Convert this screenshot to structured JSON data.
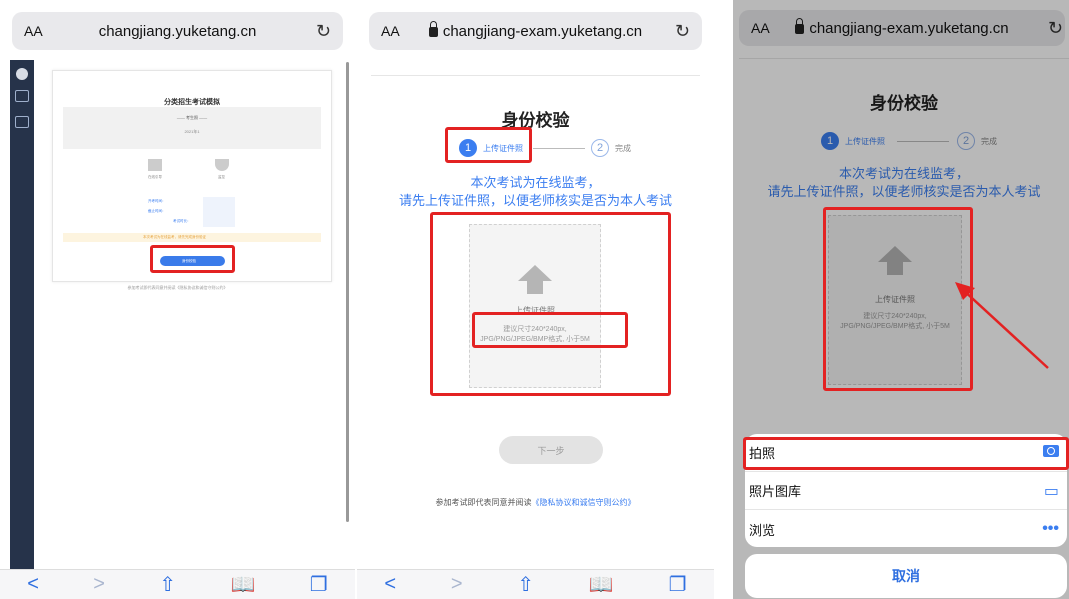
{
  "panel1": {
    "address": {
      "aa": "AA",
      "url": "changjiang.yuketang.cn",
      "reload": "↻"
    },
    "card_title": "分类招生考试模拟",
    "card_line": "—— 考生照 ——",
    "card_sub": "2021年1",
    "labels": [
      "在线引导",
      "监控"
    ],
    "info": [
      "开考时间：",
      "截止时间：",
      "考试时长："
    ],
    "warning": "本次考试为在线监考，请先完成身份验证",
    "button": "身份校验",
    "footer": "参加考试即代表同意并阅读《隐私协议和诚信守则公约》"
  },
  "panel2": {
    "address": {
      "aa": "AA",
      "url": "changjiang-exam.yuketang.cn",
      "reload": "↻"
    },
    "title": "身份校验",
    "step1_num": "1",
    "step1_label": "上传证件照",
    "step2_num": "2",
    "step2_label": "完成",
    "notice_line1": "本次考试为在线监考，",
    "notice_line2": "请先上传证件照，以便老师核实是否为本人考试",
    "upload_label": "上传证件照",
    "upload_hint1": "建议尺寸240*240px,",
    "upload_hint2": "JPG/PNG/JPEG/BMP格式, 小于5M",
    "next_button": "下一步",
    "footer_prefix": "参加考试即代表同意并阅读",
    "footer_link": "《隐私协议和诚信守则公约》"
  },
  "panel3": {
    "address": {
      "aa": "AA",
      "url": "changjiang-exam.yuketang.cn",
      "reload": "↻"
    },
    "title": "身份校验",
    "step1_num": "1",
    "step1_label": "上传证件照",
    "step2_num": "2",
    "step2_label": "完成",
    "notice_line1": "本次考试为在线监考，",
    "notice_line2": "请先上传证件照，以便老师核实是否为本人考试",
    "upload_label": "上传证件照",
    "upload_hint1": "建议尺寸240*240px,",
    "upload_hint2": "JPG/PNG/JPEG/BMP格式, 小于5M",
    "sheet": {
      "take_photo": "拍照",
      "photo_library": "照片图库",
      "browse": "浏览",
      "browse_icon": "•••",
      "cancel": "取消"
    }
  },
  "toolbar": {
    "back": "<",
    "forward": ">",
    "share": "⇧",
    "bookmarks": "📖",
    "tabs": "❐"
  },
  "colors": {
    "accent": "#3b7ef0",
    "highlight": "#e32222",
    "sidebar": "#26334a"
  }
}
